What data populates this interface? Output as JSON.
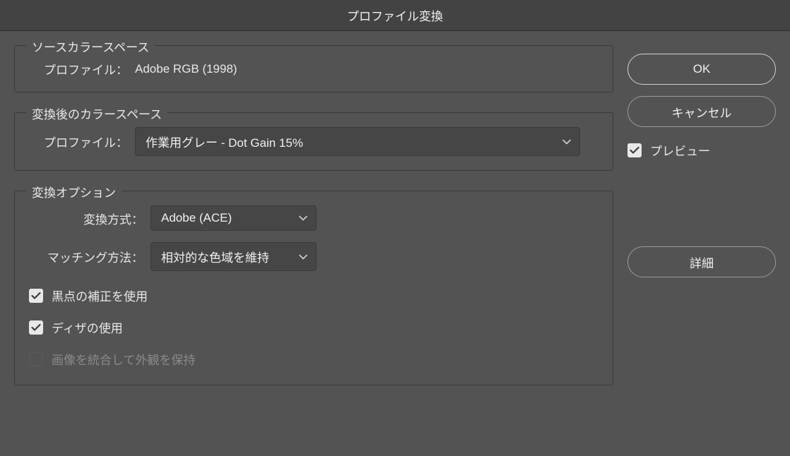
{
  "title": "プロファイル変換",
  "source": {
    "legend": "ソースカラースペース",
    "profile_label": "プロファイル：",
    "profile_value": "Adobe RGB (1998)"
  },
  "destination": {
    "legend": "変換後のカラースペース",
    "profile_label": "プロファイル：",
    "profile_value": "作業用グレー - Dot Gain 15%"
  },
  "options": {
    "legend": "変換オプション",
    "engine_label": "変換方式：",
    "engine_value": "Adobe (ACE)",
    "intent_label": "マッチング方法：",
    "intent_value": "相対的な色域を維持",
    "bpc_label": "黒点の補正を使用",
    "bpc_checked": true,
    "dither_label": "ディザの使用",
    "dither_checked": true,
    "flatten_label": "画像を統合して外観を保持",
    "flatten_checked": false,
    "flatten_disabled": true
  },
  "buttons": {
    "ok": "OK",
    "cancel": "キャンセル",
    "preview": "プレビュー",
    "preview_checked": true,
    "detail": "詳細"
  }
}
